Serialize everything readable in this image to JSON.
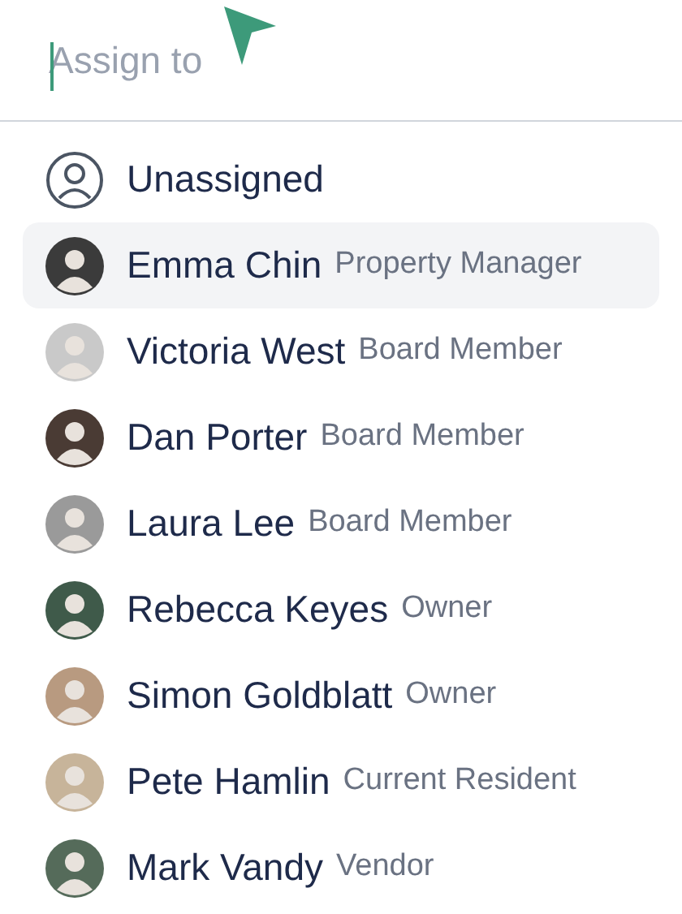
{
  "search": {
    "placeholder": "Assign to"
  },
  "options": [
    {
      "kind": "none",
      "name": "Unassigned",
      "selected": false
    },
    {
      "kind": "person",
      "name": "Emma Chin",
      "role": "Property Manager",
      "selected": true
    },
    {
      "kind": "person",
      "name": "Victoria West",
      "role": "Board Member",
      "selected": false
    },
    {
      "kind": "person",
      "name": "Dan Porter",
      "role": "Board Member",
      "selected": false
    },
    {
      "kind": "person",
      "name": "Laura Lee",
      "role": "Board Member",
      "selected": false
    },
    {
      "kind": "person",
      "name": "Rebecca Keyes",
      "role": "Owner",
      "selected": false
    },
    {
      "kind": "person",
      "name": "Simon Goldblatt",
      "role": "Owner",
      "selected": false
    },
    {
      "kind": "person",
      "name": "Pete Hamlin",
      "role": "Current Resident",
      "selected": false
    },
    {
      "kind": "person",
      "name": "Mark Vandy",
      "role": "Vendor",
      "selected": false
    }
  ]
}
